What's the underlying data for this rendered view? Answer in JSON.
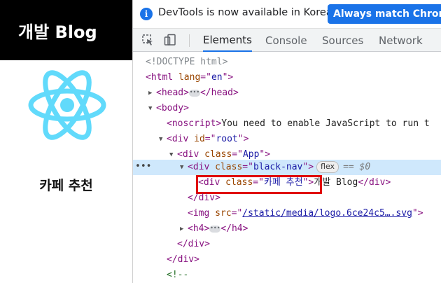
{
  "app": {
    "nav_title": "개발 Blog",
    "h4_text": "카페 추천",
    "logo_icon": "react-logo-icon",
    "logo_color": "#61dafb"
  },
  "devtools": {
    "infobar": {
      "message": "DevTools is now available in Korean!",
      "button_label": "Always match Chrome's"
    },
    "tabs": [
      {
        "label": "Elements",
        "active": true
      },
      {
        "label": "Console"
      },
      {
        "label": "Sources"
      },
      {
        "label": "Network"
      }
    ],
    "tree": {
      "doctype": "<!DOCTYPE html>",
      "html_tag": "html",
      "html_attr": "lang",
      "html_val": "en",
      "head_tag": "head",
      "body_tag": "body",
      "noscript_tag": "noscript",
      "noscript_text": "You need to enable JavaScript to run t",
      "div_tag": "div",
      "root_attr": "id",
      "root_val": "root",
      "class_attr": "class",
      "app_val": "App",
      "nav_val": "black-nav",
      "flex_badge": "flex",
      "dollar_ref": "== $0",
      "title_val": "카페 추천",
      "title_text": "개발 Blog",
      "img_tag": "img",
      "src_attr": "src",
      "img_src": "/static/media/logo.6ce24c5….svg",
      "h4_tag": "h4",
      "comment_open": "<!--"
    }
  },
  "colors": {
    "accent": "#1a73e8",
    "highlight_box": "#e00000",
    "selected_row": "#cfe8fc"
  }
}
